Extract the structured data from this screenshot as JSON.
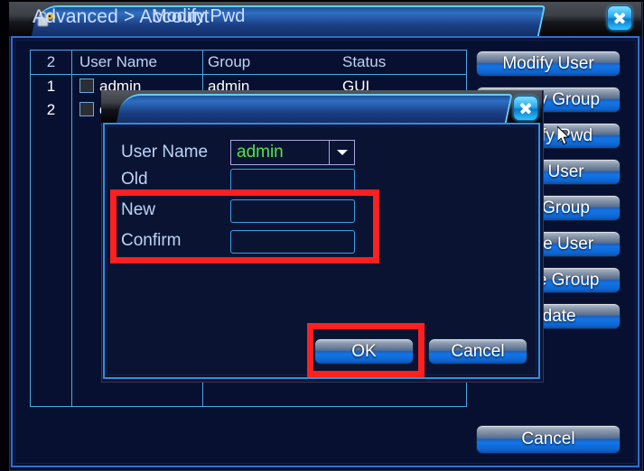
{
  "window": {
    "title": "Advanced > Account",
    "icon": "lock-key-icon",
    "close_label": "close-icon"
  },
  "table": {
    "headers": [
      "2",
      "User Name",
      "Group",
      "Status"
    ],
    "rows": [
      {
        "num": "1",
        "user": "admin",
        "group": "admin",
        "status": "GUI"
      },
      {
        "num": "2",
        "user": "d",
        "group": "",
        "status": ""
      }
    ]
  },
  "side_buttons": [
    {
      "label": "Modify User"
    },
    {
      "label": "Modify Group"
    },
    {
      "label": "Modify Pwd"
    },
    {
      "label": "Add User"
    },
    {
      "label": "Add Group"
    },
    {
      "label": "Delete User"
    },
    {
      "label": "Delete Group"
    },
    {
      "label": "Update"
    }
  ],
  "bottom": {
    "cancel_label": "Cancel"
  },
  "dialog": {
    "title": "Modify Pwd",
    "close_label": "close-icon",
    "fields": {
      "username_label": "User Name",
      "username_value": "admin",
      "username_value_color": "#55e24a",
      "old_label": "Old",
      "old_value": "",
      "new_label": "New",
      "new_value": "",
      "confirm_label": "Confirm",
      "confirm_value": ""
    },
    "ok_label": "OK",
    "cancel_label": "Cancel"
  },
  "annotations": {
    "color": "#fe2020",
    "highlight_fields": "New and Confirm password fields",
    "highlight_button": "OK button"
  }
}
